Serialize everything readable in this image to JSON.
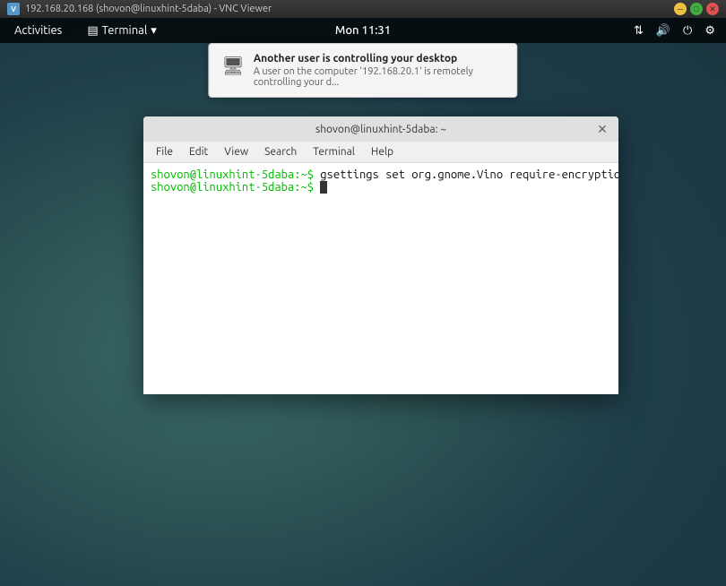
{
  "vnc": {
    "titlebar_text": "192.168.20.168 (shovon@linuxhint-5daba) - VNC Viewer",
    "icon_label": "V"
  },
  "gnome": {
    "activities_label": "Activities",
    "app_label": "Terminal",
    "clock": "Mon 11:31",
    "systray_network_icon": "⇅",
    "systray_sound_icon": "🔊",
    "systray_power_icon": "⏻",
    "systray_settings_icon": "⚙"
  },
  "notification": {
    "title": "Another user is controlling your desktop",
    "body": "A user on the computer '192.168.20.1' is remotely controlling your d..."
  },
  "terminal": {
    "title": "shovon@linuxhint-5daba: ~",
    "close_btn": "✕",
    "menu": {
      "file": "File",
      "edit": "Edit",
      "view": "View",
      "search": "Search",
      "terminal": "Terminal",
      "help": "Help"
    },
    "lines": [
      {
        "prompt": "shovon@linuxhint-5daba:~$ ",
        "command": "gsettings set org.gnome.Vino require-encryption false"
      },
      {
        "prompt": "shovon@linuxhint-5daba:~$ ",
        "command": ""
      }
    ]
  }
}
